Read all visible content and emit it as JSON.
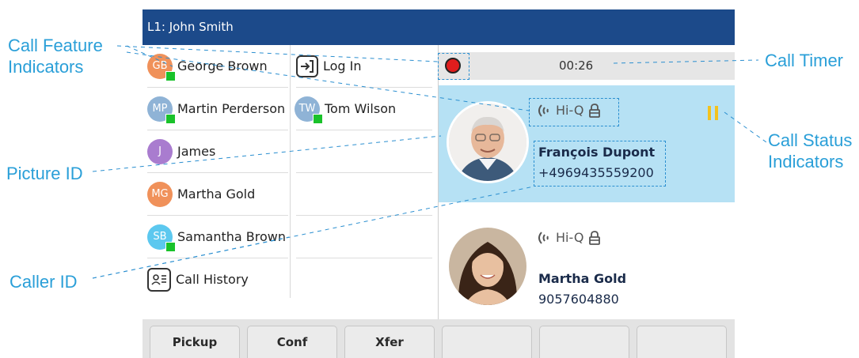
{
  "callouts": {
    "call_feature_indicators": [
      "Call Feature",
      "Indicators"
    ],
    "call_timer": "Call Timer",
    "call_status_indicators": [
      "Call Status",
      "Indicators"
    ],
    "picture_id": "Picture ID",
    "caller_id": "Caller ID"
  },
  "header": {
    "title": "L1: John Smith"
  },
  "contacts": [
    {
      "initials": "GB",
      "name": "George Brown",
      "color": "#f0915a",
      "presence": true
    },
    {
      "initials": "MP",
      "name": "Martin Perderson",
      "color": "#8fb3d6",
      "presence": true
    },
    {
      "initials": "J",
      "name": "James",
      "color": "#a97ccf",
      "presence": false
    },
    {
      "initials": "MG",
      "name": "Martha Gold",
      "color": "#f0915a",
      "presence": false
    },
    {
      "initials": "SB",
      "name": "Samantha Brown",
      "color": "#5cc8ef",
      "presence": true
    }
  ],
  "call_history": {
    "label": "Call History",
    "icon": "contact-card-icon"
  },
  "second_column": {
    "login": {
      "label": "Log In",
      "icon": "login-icon"
    },
    "contact": {
      "initials": "TW",
      "name": "Tom Wilson",
      "color": "#8fb3d6",
      "presence": true
    }
  },
  "call_bar": {
    "recording_icon": "record-icon",
    "timer": "00:26"
  },
  "calls": [
    {
      "name": "François Dupont",
      "number": "+4969435559200",
      "hiq": "Hi-Q",
      "status_icon": "pause-icon",
      "active": true
    },
    {
      "name": "Martha Gold",
      "number": "9057604880",
      "hiq": "Hi-Q",
      "active": false
    }
  ],
  "softkeys": [
    "Pickup",
    "Conf",
    "Xfer",
    "",
    "",
    ""
  ],
  "colors": {
    "title_bar": "#1c4a8a",
    "active_call_bg": "#b6e1f4",
    "callout_text": "#2a9fd8",
    "presence": "#19c22a",
    "pause": "#f3c21e"
  }
}
